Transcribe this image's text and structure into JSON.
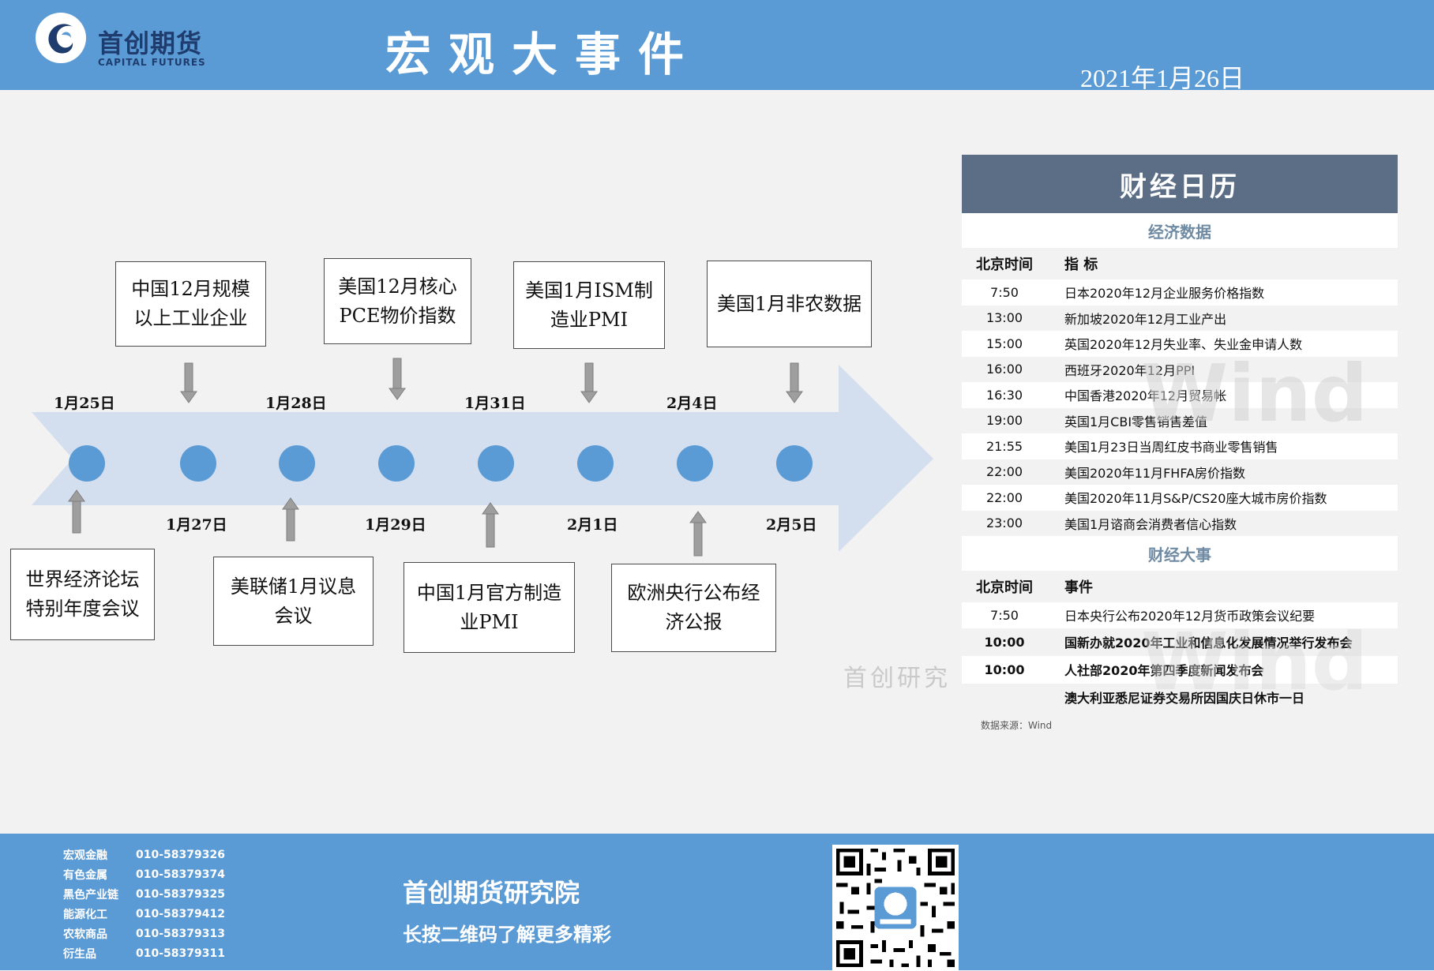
{
  "header": {
    "logo_cn": "首创期货",
    "logo_en": "CAPITAL FUTURES",
    "title": "宏观大事件",
    "date": "2021年1月26日"
  },
  "timeline": {
    "top_dates": [
      "1月25日",
      "1月28日",
      "1月31日",
      "2月4日"
    ],
    "bottom_dates": [
      "1月27日",
      "1月29日",
      "2月1日",
      "2月5日"
    ],
    "top_events": [
      "中国12月规模以上工业企业",
      "美国12月核心PCE物价指数",
      "美国1月ISM制造业PMI",
      "美国1月非农数据"
    ],
    "bottom_events": [
      "世界经济论坛特别年度会议",
      "美联储1月议息会议",
      "中国1月官方制造业PMI",
      "欧洲央行公布经济公报"
    ],
    "watermark": "首创研究"
  },
  "calendar": {
    "title": "财经日历",
    "econ_section": "经济数据",
    "col_time": "北京时间",
    "col_indicator": "指 标",
    "econ_rows": [
      {
        "time": "7:50",
        "text": "日本2020年12月企业服务价格指数"
      },
      {
        "time": "13:00",
        "text": "新加坡2020年12月工业产出"
      },
      {
        "time": "15:00",
        "text": "英国2020年12月失业率、失业金申请人数"
      },
      {
        "time": "16:00",
        "text": "西班牙2020年12月PPI"
      },
      {
        "time": "16:30",
        "text": "中国香港2020年12月贸易帐"
      },
      {
        "time": "19:00",
        "text": "英国1月CBI零售销售差值"
      },
      {
        "time": "21:55",
        "text": "美国1月23日当周红皮书商业零售销售"
      },
      {
        "time": "22:00",
        "text": "美国2020年11月FHFA房价指数"
      },
      {
        "time": "22:00",
        "text": "美国2020年11月S&P/CS20座大城市房价指数"
      },
      {
        "time": "23:00",
        "text": "美国1月谘商会消费者信心指数"
      }
    ],
    "event_section": "财经大事",
    "col_event": "事件",
    "event_rows": [
      {
        "time": "7:50",
        "text": "日本央行公布2020年12月货币政策会议纪要"
      },
      {
        "time": "10:00",
        "text": "国新办就2020年工业和信息化发展情况举行发布会"
      },
      {
        "time": "10:00",
        "text": "人社部2020年第四季度新闻发布会"
      },
      {
        "time": "",
        "text": "澳大利亚悉尼证券交易所因国庆日休市一日"
      }
    ],
    "source": "数据来源：Wind",
    "watermark": "Wind"
  },
  "footer": {
    "contacts": [
      {
        "name": "宏观金融",
        "phone": "010-58379326"
      },
      {
        "name": "有色金属",
        "phone": "010-58379374"
      },
      {
        "name": "黑色产业链",
        "phone": "010-58379325"
      },
      {
        "name": "能源化工",
        "phone": "010-58379412"
      },
      {
        "name": "农软商品",
        "phone": "010-58379313"
      },
      {
        "name": "衍生品",
        "phone": "010-58379311"
      }
    ],
    "title": "首创期货研究院",
    "subtitle": "长按二维码了解更多精彩"
  },
  "colors": {
    "header_blue": "#5b9bd5",
    "arrow": "#d3deee",
    "dot": "#5b9bd5",
    "calendar_header": "#5b6e85"
  }
}
